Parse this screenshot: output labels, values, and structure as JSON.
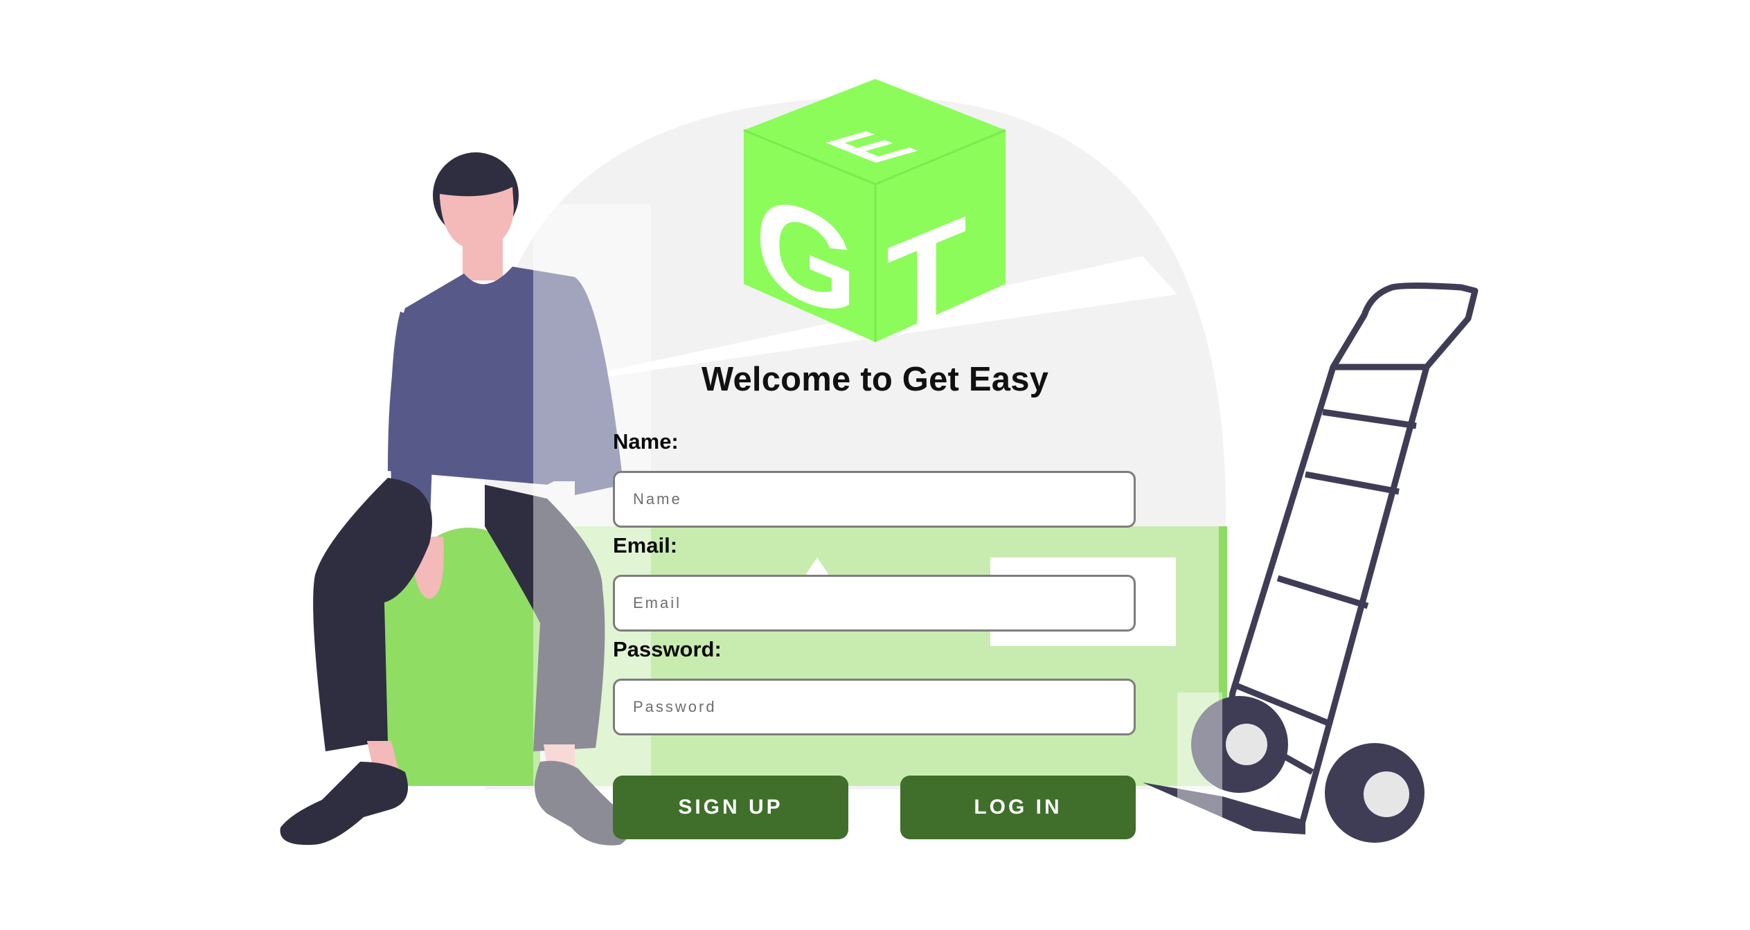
{
  "brand": {
    "logo_letters": [
      "E",
      "G",
      "T"
    ],
    "accent_color": "#8cfc5a",
    "button_color": "#3f6f2a"
  },
  "title": "Welcome to Get Easy",
  "form": {
    "name_label": "Name:",
    "name_placeholder": "Name",
    "email_label": "Email:",
    "email_placeholder": "Email",
    "password_label": "Password:",
    "password_placeholder": "Password",
    "signup_label": "SIGN UP",
    "login_label": "LOG IN"
  }
}
